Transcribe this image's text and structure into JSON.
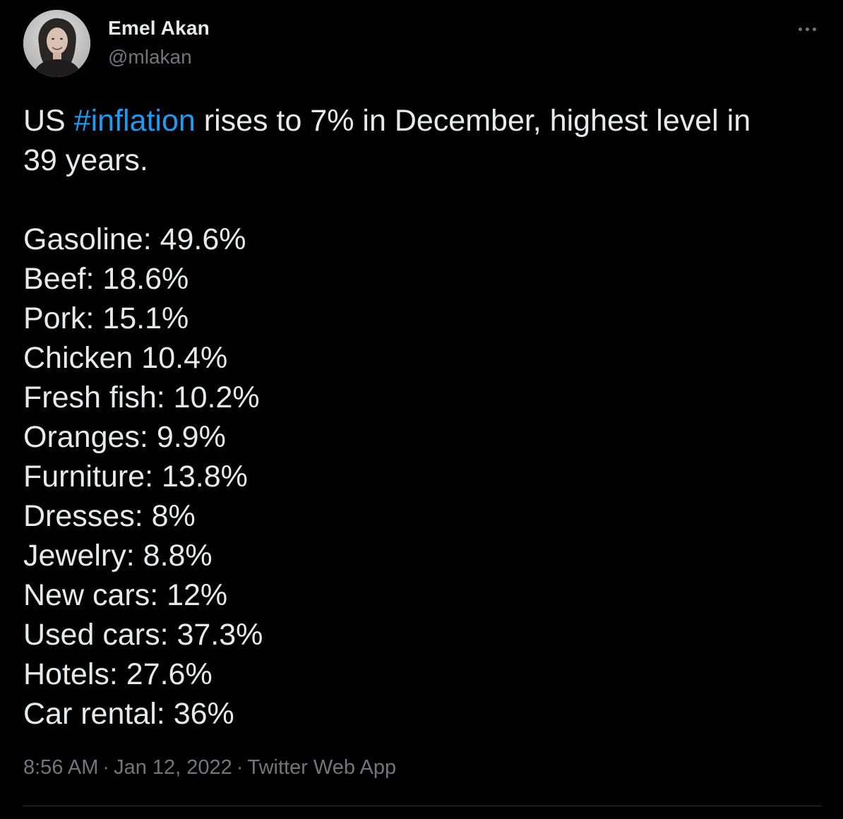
{
  "author": {
    "display_name": "Emel Akan",
    "handle": "@mlakan"
  },
  "tweet": {
    "text_before_hashtag": "US ",
    "hashtag": "#inflation",
    "text_after_hashtag": " rises to 7% in December, highest level in",
    "text_line2": "39 years.",
    "items": [
      "Gasoline: 49.6%",
      "Beef: 18.6%",
      "Pork: 15.1%",
      "Chicken 10.4%",
      "Fresh fish: 10.2%",
      "Oranges: 9.9%",
      "Furniture: 13.8%",
      "Dresses: 8%",
      "Jewelry: 8.8%",
      "New cars: 12%",
      "Used cars: 37.3%",
      "Hotels: 27.6%",
      "Car rental: 36%"
    ]
  },
  "meta": {
    "time": "8:56 AM",
    "separator": "·",
    "date": "Jan 12, 2022",
    "source": "Twitter Web App"
  },
  "icons": {
    "more": "more-horizontal-icon",
    "avatar": "profile-photo"
  },
  "colors": {
    "background": "#000000",
    "text": "#e7e9ea",
    "muted": "#71767b",
    "link": "#1d9bf0",
    "divider": "#2f3336"
  }
}
